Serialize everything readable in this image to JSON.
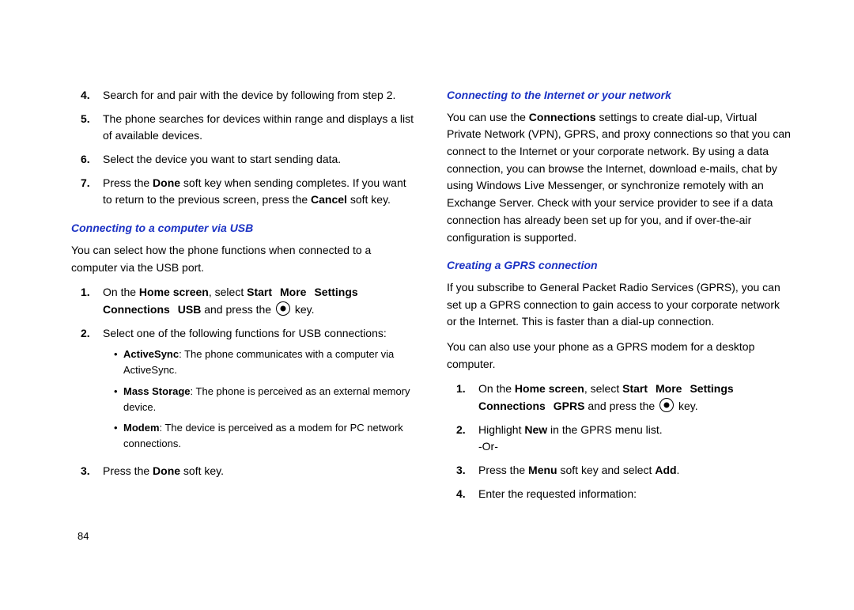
{
  "pageNumber": "84",
  "left": {
    "steps_top": [
      {
        "n": "4.",
        "text": "Search for and pair with the device by following from step 2."
      },
      {
        "n": "5.",
        "text": "The phone searches for devices within range and displays a list of available devices."
      },
      {
        "n": "6.",
        "text": "Select the device you want to start sending data."
      },
      {
        "n": "7.",
        "parts": [
          {
            "t": "Press the "
          },
          {
            "t": "Done",
            "b": true
          },
          {
            "t": " soft key when sending completes. If you want to return to the previous screen, press the "
          },
          {
            "t": "Cancel",
            "b": true
          },
          {
            "t": " soft key."
          }
        ]
      }
    ],
    "heading1": "Connecting to a computer via USB",
    "para1": "You can select how the phone functions when connected to a computer via the USB port.",
    "steps_usb": [
      {
        "n": "1.",
        "parts": [
          {
            "t": "On the "
          },
          {
            "t": "Home screen",
            "b": true
          },
          {
            "t": ", select "
          },
          {
            "t": "Start",
            "b": true
          },
          {
            "sep": true
          },
          {
            "t": "More",
            "b": true
          },
          {
            "sep": true
          },
          {
            "t": "Settings",
            "b": true
          },
          {
            "sep": true
          },
          {
            "t": "Connections",
            "b": true
          },
          {
            "sep": true
          },
          {
            "t": "USB",
            "b": true
          },
          {
            "t": " and press the "
          },
          {
            "icon": true
          },
          {
            "t": " key."
          }
        ]
      },
      {
        "n": "2.",
        "text": "Select one of the following functions for USB connections:",
        "bullets": [
          {
            "parts": [
              {
                "t": "ActiveSync",
                "b": true
              },
              {
                "t": ": The phone communicates with a computer via ActiveSync."
              }
            ]
          },
          {
            "parts": [
              {
                "t": "Mass Storage",
                "b": true
              },
              {
                "t": ": The phone is perceived as an external memory device."
              }
            ]
          },
          {
            "parts": [
              {
                "t": "Modem",
                "b": true
              },
              {
                "t": ": The device is perceived as a modem for PC network connections."
              }
            ]
          }
        ]
      },
      {
        "n": "3.",
        "parts": [
          {
            "t": "Press the "
          },
          {
            "t": "Done",
            "b": true
          },
          {
            "t": " soft key."
          }
        ]
      }
    ]
  },
  "right": {
    "heading2": "Connecting to the Internet or your network",
    "para2_parts": [
      {
        "t": "You can use the "
      },
      {
        "t": "Connections",
        "b": true
      },
      {
        "t": " settings to create dial-up, Virtual Private Network (VPN), GPRS, and proxy connections so that you can connect to the Internet or your corporate network. By using a data connection, you can browse the Internet, download e-mails, chat by using Windows Live Messenger, or synchronize remotely with an Exchange Server. Check with your service provider to see if a data connection has already been set up for you, and if over-the-air configuration is supported."
      }
    ],
    "heading3": "Creating a GPRS connection",
    "para3": "If you subscribe to General Packet Radio Services (GPRS), you can set up a GPRS connection to gain access to your corporate network or the Internet. This is faster than a dial-up connection.",
    "para4": "You can also use your phone as a GPRS modem for a desktop computer.",
    "steps_gprs": [
      {
        "n": "1.",
        "parts": [
          {
            "t": "On the "
          },
          {
            "t": "Home screen",
            "b": true
          },
          {
            "t": ", select "
          },
          {
            "t": "Start",
            "b": true
          },
          {
            "sep": true
          },
          {
            "t": "More",
            "b": true
          },
          {
            "sep": true
          },
          {
            "t": "Settings",
            "b": true
          },
          {
            "sep": true
          },
          {
            "t": "Connections",
            "b": true
          },
          {
            "sep": true
          },
          {
            "t": "GPRS",
            "b": true
          },
          {
            "t": " and press the "
          },
          {
            "icon": true
          },
          {
            "t": " key."
          }
        ]
      },
      {
        "n": "2.",
        "parts": [
          {
            "t": "Highlight "
          },
          {
            "t": "New",
            "b": true
          },
          {
            "t": " in the GPRS menu list."
          }
        ],
        "after": "-Or-"
      },
      {
        "n": "3.",
        "parts": [
          {
            "t": "Press the "
          },
          {
            "t": "Menu",
            "b": true
          },
          {
            "t": " soft key and select "
          },
          {
            "t": "Add",
            "b": true
          },
          {
            "t": "."
          }
        ]
      },
      {
        "n": "4.",
        "text": "Enter the requested information:"
      }
    ]
  }
}
